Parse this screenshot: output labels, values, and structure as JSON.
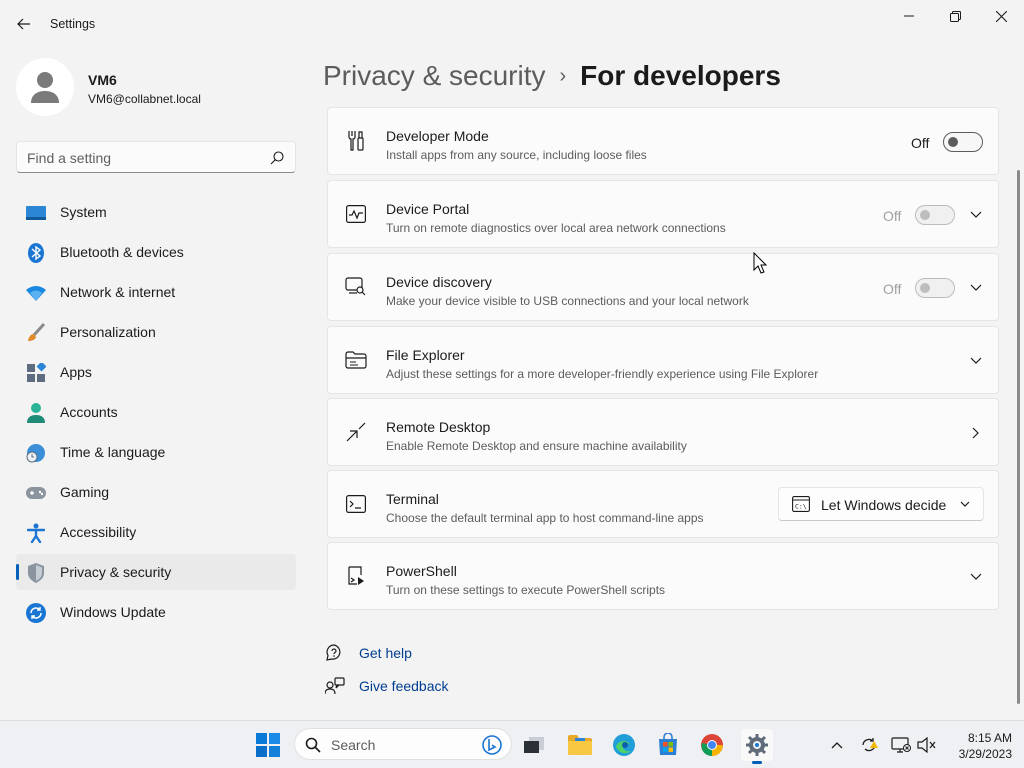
{
  "window": {
    "title": "Settings"
  },
  "profile": {
    "name": "VM6",
    "email": "VM6@collabnet.local"
  },
  "search": {
    "placeholder": "Find a setting"
  },
  "nav": {
    "items": [
      {
        "label": "System",
        "icon": "system-icon"
      },
      {
        "label": "Bluetooth & devices",
        "icon": "bluetooth-icon"
      },
      {
        "label": "Network & internet",
        "icon": "wifi-icon"
      },
      {
        "label": "Personalization",
        "icon": "brush-icon"
      },
      {
        "label": "Apps",
        "icon": "apps-icon"
      },
      {
        "label": "Accounts",
        "icon": "person-icon"
      },
      {
        "label": "Time & language",
        "icon": "globe-clock-icon"
      },
      {
        "label": "Gaming",
        "icon": "gamepad-icon"
      },
      {
        "label": "Accessibility",
        "icon": "accessibility-icon"
      },
      {
        "label": "Privacy & security",
        "icon": "shield-icon",
        "active": true
      },
      {
        "label": "Windows Update",
        "icon": "update-icon"
      }
    ]
  },
  "breadcrumb": {
    "parent": "Privacy & security",
    "separator": "›",
    "current": "For developers"
  },
  "cards": {
    "developer_mode": {
      "title": "Developer Mode",
      "description": "Install apps from any source, including loose files",
      "toggle_label": "Off",
      "icon": "developer-tools-icon"
    },
    "device_portal": {
      "title": "Device Portal",
      "description": "Turn on remote diagnostics over local area network connections",
      "toggle_label": "Off",
      "icon": "pulse-icon"
    },
    "device_discovery": {
      "title": "Device discovery",
      "description": "Make your device visible to USB connections and your local network",
      "toggle_label": "Off",
      "icon": "device-search-icon"
    },
    "file_explorer": {
      "title": "File Explorer",
      "description": "Adjust these settings for a more developer-friendly experience using File Explorer",
      "icon": "folder-icon"
    },
    "remote_desktop": {
      "title": "Remote Desktop",
      "description": "Enable Remote Desktop and ensure machine availability",
      "icon": "remote-desktop-icon"
    },
    "terminal": {
      "title": "Terminal",
      "description": "Choose the default terminal app to host command-line apps",
      "dropdown_value": "Let Windows decide",
      "icon": "terminal-icon"
    },
    "powershell": {
      "title": "PowerShell",
      "description": "Turn on these settings to execute PowerShell scripts",
      "icon": "powershell-icon"
    }
  },
  "help": {
    "get_help": "Get help",
    "give_feedback": "Give feedback"
  },
  "taskbar": {
    "search_label": "Search",
    "time": "8:15 AM",
    "date": "3/29/2023"
  },
  "colors": {
    "accent": "#005fb8",
    "link": "#003e92"
  }
}
